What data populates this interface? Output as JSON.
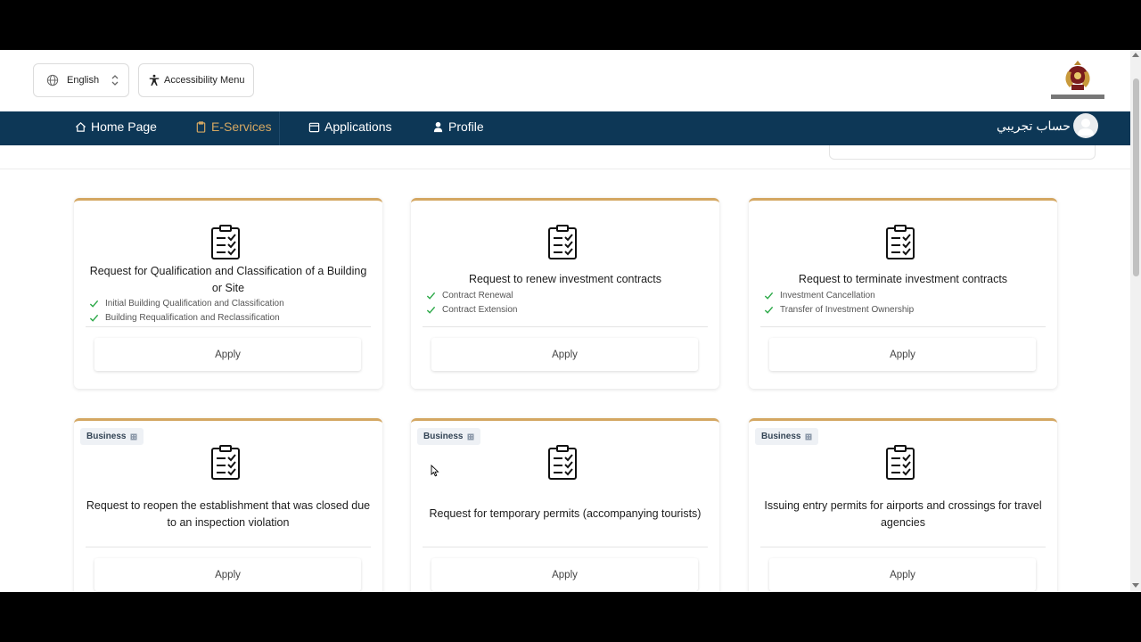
{
  "topbar": {
    "language_label": "English",
    "accessibility_label": "Accessibility Menu"
  },
  "nav": {
    "items": [
      {
        "label": "Home Page",
        "icon": "home-icon"
      },
      {
        "label": "E-Services",
        "icon": "clipboard-icon",
        "active": true
      },
      {
        "label": "Applications",
        "icon": "calendar-icon"
      },
      {
        "label": "Profile",
        "icon": "user-icon"
      }
    ],
    "profile_name": "حساب تجريبي"
  },
  "colors": {
    "nav_bg": "#0d3756",
    "accent_gold": "#d4a762",
    "check_green": "#2eaa4a"
  },
  "cards": [
    {
      "title": "Request for Qualification and Classification of a Building or Site",
      "features": [
        "Initial Building Qualification and Classification",
        "Building Requalification and Reclassification"
      ],
      "apply_label": "Apply"
    },
    {
      "title": "Request to renew investment contracts",
      "features": [
        "Contract Renewal",
        "Contract Extension"
      ],
      "apply_label": "Apply"
    },
    {
      "title": "Request to terminate investment contracts",
      "features": [
        "Investment Cancellation",
        "Transfer of Investment Ownership"
      ],
      "apply_label": "Apply"
    },
    {
      "badge": "Business",
      "title": "Request to reopen the establishment that was closed due to an inspection violation",
      "apply_label": "Apply"
    },
    {
      "badge": "Business",
      "title": "Request for temporary permits (accompanying tourists)",
      "apply_label": "Apply"
    },
    {
      "badge": "Business",
      "title": "Issuing entry permits for airports and crossings for travel agencies",
      "apply_label": "Apply"
    }
  ]
}
